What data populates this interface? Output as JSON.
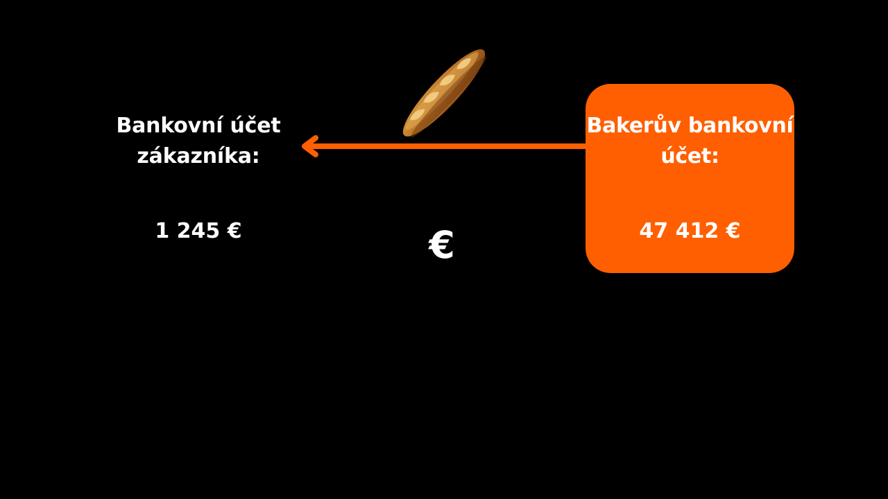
{
  "customer_account": {
    "title": "Bankovní účet zákazníka:",
    "amount": "1 245 €"
  },
  "baker_account": {
    "title": "Bakerův bankovní účet:",
    "amount": "47 412 €"
  },
  "transfer": {
    "currency_symbol": "€",
    "item_icon": "baguette-icon",
    "direction_icon": "arrow-left-icon"
  },
  "colors": {
    "background": "#000000",
    "accent": "#ff5f00",
    "text": "#ffffff"
  }
}
